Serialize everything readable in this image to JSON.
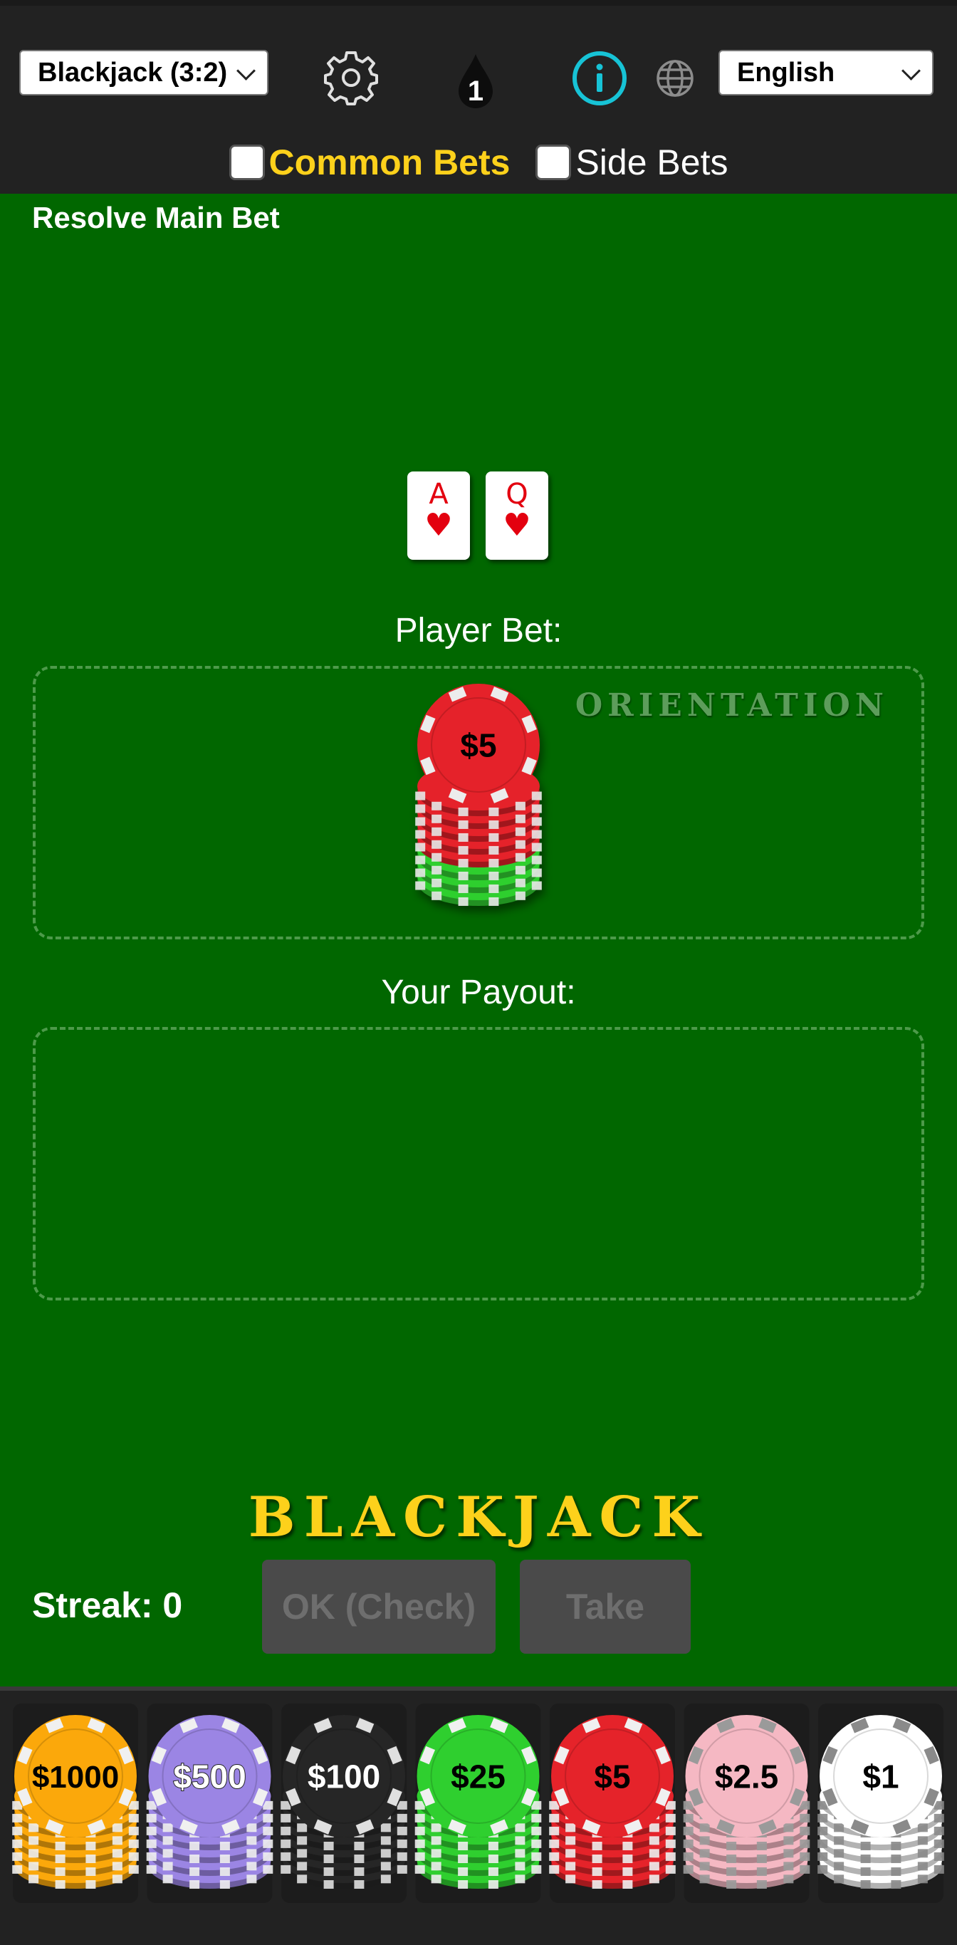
{
  "header": {
    "game_select": "Blackjack (3:2)",
    "counter_value": "1",
    "language_select": "English",
    "tabs": [
      {
        "label": "Common Bets",
        "active": true
      },
      {
        "label": "Side Bets",
        "active": false
      }
    ]
  },
  "table": {
    "phase_label": "Resolve Main Bet",
    "cards": [
      {
        "rank": "A",
        "suit": "♥"
      },
      {
        "rank": "Q",
        "suit": "♥"
      }
    ],
    "player_bet_label": "Player Bet:",
    "player_bet_chip": "$5",
    "orientation_watermark": "ORIENTATION",
    "payout_label": "Your Payout:",
    "game_title": "BLACKJACK",
    "streak_label": "Streak: 0",
    "buttons": {
      "ok_check": "OK (Check)",
      "take": "Take"
    }
  },
  "chips": [
    {
      "label": "$1000",
      "color": "#fba80b",
      "stripe": "#f0f0f0",
      "text": "#000000"
    },
    {
      "label": "$500",
      "color": "#9b85e4",
      "stripe": "#f0f0f0",
      "text": "#ffffff"
    },
    {
      "label": "$100",
      "color": "#262626",
      "stripe": "#e0e0e0",
      "text": "#ffffff"
    },
    {
      "label": "$25",
      "color": "#2fcf2f",
      "stripe": "#f0f0f0",
      "text": "#000000"
    },
    {
      "label": "$5",
      "color": "#e5232a",
      "stripe": "#f0f0f0",
      "text": "#000000"
    },
    {
      "label": "$2.5",
      "color": "#f5b8c3",
      "stripe": "#9a9a9a",
      "text": "#000000"
    },
    {
      "label": "$1",
      "color": "#ffffff",
      "stripe": "#8a8a8a",
      "text": "#000000"
    }
  ],
  "colors": {
    "felt": "#016700",
    "header": "#222222",
    "accent_yellow": "#fdd11b",
    "info_cyan": "#17c3d6",
    "bet_chip_red": "#e5232a",
    "bet_chip_green": "#2fcf2f"
  },
  "icons": [
    "gear-icon",
    "drop-counter-icon",
    "info-icon",
    "globe-icon"
  ]
}
